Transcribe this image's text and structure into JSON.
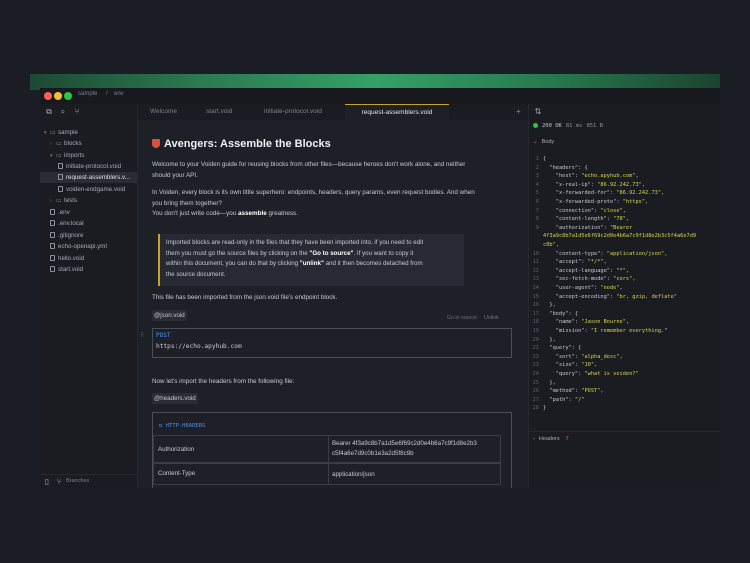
{
  "window": {
    "breadcrumb": [
      "sample",
      "env"
    ]
  },
  "sidebar": {
    "root": "sample",
    "items": [
      {
        "label": "blocks",
        "type": "folder",
        "open": false,
        "depth": 1
      },
      {
        "label": "imports",
        "type": "folder",
        "open": true,
        "depth": 1
      },
      {
        "label": "initiate-protocol.void",
        "type": "file",
        "depth": 2
      },
      {
        "label": "request-assemblers.v...",
        "type": "file",
        "depth": 2,
        "active": true
      },
      {
        "label": "voiden-endgame.void",
        "type": "file",
        "depth": 2
      },
      {
        "label": "tests",
        "type": "folder",
        "open": false,
        "depth": 1
      },
      {
        "label": ".env",
        "type": "file",
        "depth": 1
      },
      {
        "label": ".env.local",
        "type": "file",
        "depth": 1
      },
      {
        "label": ".gitignore",
        "type": "file",
        "depth": 1
      },
      {
        "label": "echo-openapi.yml",
        "type": "file",
        "depth": 1
      },
      {
        "label": "hello.void",
        "type": "file",
        "depth": 1
      },
      {
        "label": "start.void",
        "type": "file",
        "depth": 1
      }
    ],
    "bottom_label": "Branches"
  },
  "tabs": [
    {
      "label": "Welcome"
    },
    {
      "label": "start.void"
    },
    {
      "label": "initiate-protocol.void"
    },
    {
      "label": "request-assemblers.void",
      "active": true
    }
  ],
  "editor": {
    "title": "Avengers: Assemble the Blocks",
    "intro_1": "Welcome to your Voiden guide for reusing blocks from other files—because heroes don't work alone, and neither",
    "intro_2": "should your API.",
    "p2_1": "In Voiden, every block is its own little superhero: endpoints, headers, query params, even request bodies. And when",
    "p2_2": "you bring them together?",
    "p2_3a": "You don't just write code—you ",
    "p2_3b": "assemble",
    "p2_3c": " greatness.",
    "callout_1": "Imported blocks are read-only in the files that they have been imported into, if you need to edit",
    "callout_2a": "them you must go the source files by clicking on the ",
    "callout_2b": "\"Go to source\"",
    "callout_2c": ". If you want to copy it",
    "callout_3a": "within this document, you can do that by clicking ",
    "callout_3b": "\"unlink\"",
    "callout_3c": " and it then becomes detached from",
    "callout_4": "the source document.",
    "import_note": "This file has been imported from the json.void file's endpoint block.",
    "tag_json": "@json.void",
    "go_to_source": "Go to source",
    "unlink": "Unlink",
    "method": "POST",
    "url": "https://echo.apyhub.com",
    "headers_note": "Now let's import the headers from the following file:",
    "tag_headers": "@headers.void",
    "headers_block_title": "HTTP-HEADERS",
    "headers": [
      {
        "key": "Authorization",
        "value_1": "Bearer 4f3a9c8b7a1d5e6f69c2d0e4b6a7c9f1d8e2b3",
        "value_2": "c5f4a6e7d9c0b1e3a2d5f8c9b"
      },
      {
        "key": "Content-Type",
        "value_1": "application/json",
        "value_2": ""
      }
    ]
  },
  "response": {
    "status": "200 OK",
    "time": "81 ms",
    "size": "851 B",
    "body_label": "Body",
    "headers_label": "Headers",
    "headers_count": "7",
    "lines": [
      {
        "n": "1",
        "parts": [
          [
            "k",
            "{"
          ]
        ]
      },
      {
        "n": "2",
        "parts": [
          [
            "k",
            "  \"headers\": {"
          ]
        ]
      },
      {
        "n": "3",
        "parts": [
          [
            "k",
            "    \"host\": "
          ],
          [
            "s",
            "\"echo.apyhub.com\""
          ],
          [
            "k",
            ","
          ]
        ]
      },
      {
        "n": "4",
        "parts": [
          [
            "k",
            "    \"x-real-ip\": "
          ],
          [
            "s",
            "\"86.92.242.73\""
          ],
          [
            "k",
            ","
          ]
        ]
      },
      {
        "n": "5",
        "parts": [
          [
            "k",
            "    \"x-forwarded-for\": "
          ],
          [
            "s",
            "\"86.92.242.73\""
          ],
          [
            "k",
            ","
          ]
        ]
      },
      {
        "n": "6",
        "parts": [
          [
            "k",
            "    \"x-forwarded-proto\": "
          ],
          [
            "s",
            "\"https\""
          ],
          [
            "k",
            ","
          ]
        ]
      },
      {
        "n": "7",
        "parts": [
          [
            "k",
            "    \"connection\": "
          ],
          [
            "s",
            "\"close\""
          ],
          [
            "k",
            ","
          ]
        ]
      },
      {
        "n": "8",
        "parts": [
          [
            "k",
            "    \"content-length\": "
          ],
          [
            "s",
            "\"78\""
          ],
          [
            "k",
            ","
          ]
        ]
      },
      {
        "n": "9",
        "parts": [
          [
            "k",
            "    \"authorization\": "
          ],
          [
            "s",
            "\"Bearer"
          ]
        ]
      },
      {
        "n": "",
        "parts": [
          [
            "s",
            "4f3a9c8b7a1d5e6f69c2d0e4b6a7c9f1d8e2b3c5f4a6e7d9"
          ]
        ]
      },
      {
        "n": "",
        "parts": [
          [
            "s",
            "c0b\""
          ],
          [
            "k",
            ","
          ]
        ]
      },
      {
        "n": "10",
        "parts": [
          [
            "k",
            "    \"content-type\": "
          ],
          [
            "s",
            "\"application/json\""
          ],
          [
            "k",
            ","
          ]
        ]
      },
      {
        "n": "11",
        "parts": [
          [
            "k",
            "    \"accept\": "
          ],
          [
            "s",
            "\"*/*\""
          ],
          [
            "k",
            ","
          ]
        ]
      },
      {
        "n": "12",
        "parts": [
          [
            "k",
            "    \"accept-language\": "
          ],
          [
            "s",
            "\"*\""
          ],
          [
            "k",
            ","
          ]
        ]
      },
      {
        "n": "13",
        "parts": [
          [
            "k",
            "    \"sec-fetch-mode\": "
          ],
          [
            "s",
            "\"cors\""
          ],
          [
            "k",
            ","
          ]
        ]
      },
      {
        "n": "14",
        "parts": [
          [
            "k",
            "    \"user-agent\": "
          ],
          [
            "s",
            "\"node\""
          ],
          [
            "k",
            ","
          ]
        ]
      },
      {
        "n": "15",
        "parts": [
          [
            "k",
            "    \"accept-encoding\": "
          ],
          [
            "s",
            "\"br, gzip, deflate\""
          ]
        ]
      },
      {
        "n": "16",
        "parts": [
          [
            "k",
            "  },"
          ]
        ]
      },
      {
        "n": "17",
        "parts": [
          [
            "k",
            "  \"body\": {"
          ]
        ]
      },
      {
        "n": "18",
        "parts": [
          [
            "k",
            "    \"name\": "
          ],
          [
            "s",
            "\"Jason Bourne\""
          ],
          [
            "k",
            ","
          ]
        ]
      },
      {
        "n": "19",
        "parts": [
          [
            "k",
            "    \"mission\": "
          ],
          [
            "s",
            "\"I remember everything.\""
          ]
        ]
      },
      {
        "n": "20",
        "parts": [
          [
            "k",
            "  },"
          ]
        ]
      },
      {
        "n": "21",
        "parts": [
          [
            "k",
            "  \"query\": {"
          ]
        ]
      },
      {
        "n": "22",
        "parts": [
          [
            "k",
            "    \"sort\": "
          ],
          [
            "s",
            "\"alpha_desc\""
          ],
          [
            "k",
            ","
          ]
        ]
      },
      {
        "n": "23",
        "parts": [
          [
            "k",
            "    \"size\": "
          ],
          [
            "s",
            "\"10\""
          ],
          [
            "k",
            ","
          ]
        ]
      },
      {
        "n": "24",
        "parts": [
          [
            "k",
            "    \"query\": "
          ],
          [
            "s",
            "\"what is voiden?\""
          ]
        ]
      },
      {
        "n": "25",
        "parts": [
          [
            "k",
            "  },"
          ]
        ]
      },
      {
        "n": "26",
        "parts": [
          [
            "k",
            "  \"method\": "
          ],
          [
            "s",
            "\"POST\""
          ],
          [
            "k",
            ","
          ]
        ]
      },
      {
        "n": "27",
        "parts": [
          [
            "k",
            "  \"path\": "
          ],
          [
            "s",
            "\"/\""
          ]
        ]
      },
      {
        "n": "28",
        "parts": [
          [
            "k",
            "}"
          ]
        ]
      }
    ]
  },
  "colors": {
    "accent": "#c9a227",
    "method": "#4c90f0",
    "string": "#d4d94f",
    "status_ok": "#28c840"
  },
  "icons": [
    "copy-icon",
    "search-icon",
    "git-icon",
    "chevron-down-icon",
    "folder-icon",
    "file-icon",
    "plus-icon",
    "sort-icon",
    "shield-icon",
    "panel-icon"
  ]
}
